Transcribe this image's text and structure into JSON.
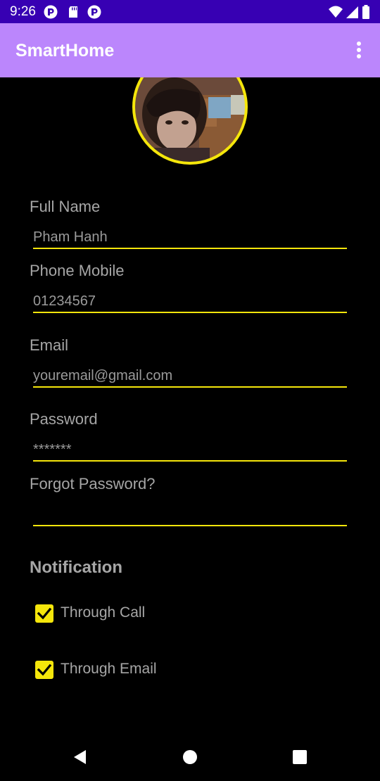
{
  "status_bar": {
    "time": "9:26",
    "notification_icons": [
      "pocket-casts-icon",
      "sd-card-icon",
      "pocket-casts-icon"
    ],
    "system_icons": [
      "wifi-icon",
      "cell-signal-icon",
      "battery-icon"
    ]
  },
  "app_bar": {
    "title": "SmartHome",
    "menu_icon": "more-vertical-icon",
    "background_color": "#bb86fc"
  },
  "profile": {
    "avatar_border_color": "#f5e60b"
  },
  "form": {
    "full_name": {
      "label": "Full Name",
      "value": "Pham Hanh"
    },
    "phone": {
      "label": "Phone Mobile",
      "value": "01234567"
    },
    "email": {
      "label": "Email",
      "value": "youremail@gmail.com"
    },
    "password": {
      "label": "Password",
      "value": "*******"
    },
    "forgot_password": {
      "label": "Forgot Password?",
      "value": ""
    }
  },
  "notification": {
    "title": "Notification",
    "options": [
      {
        "label": "Through Call",
        "checked": true
      },
      {
        "label": "Through Email",
        "checked": true
      }
    ]
  },
  "nav_bar": {
    "buttons": [
      "back-icon",
      "home-icon",
      "recents-icon"
    ]
  },
  "colors": {
    "status_bar": "#3700b3",
    "accent": "#f5e60b",
    "background": "#000000"
  }
}
